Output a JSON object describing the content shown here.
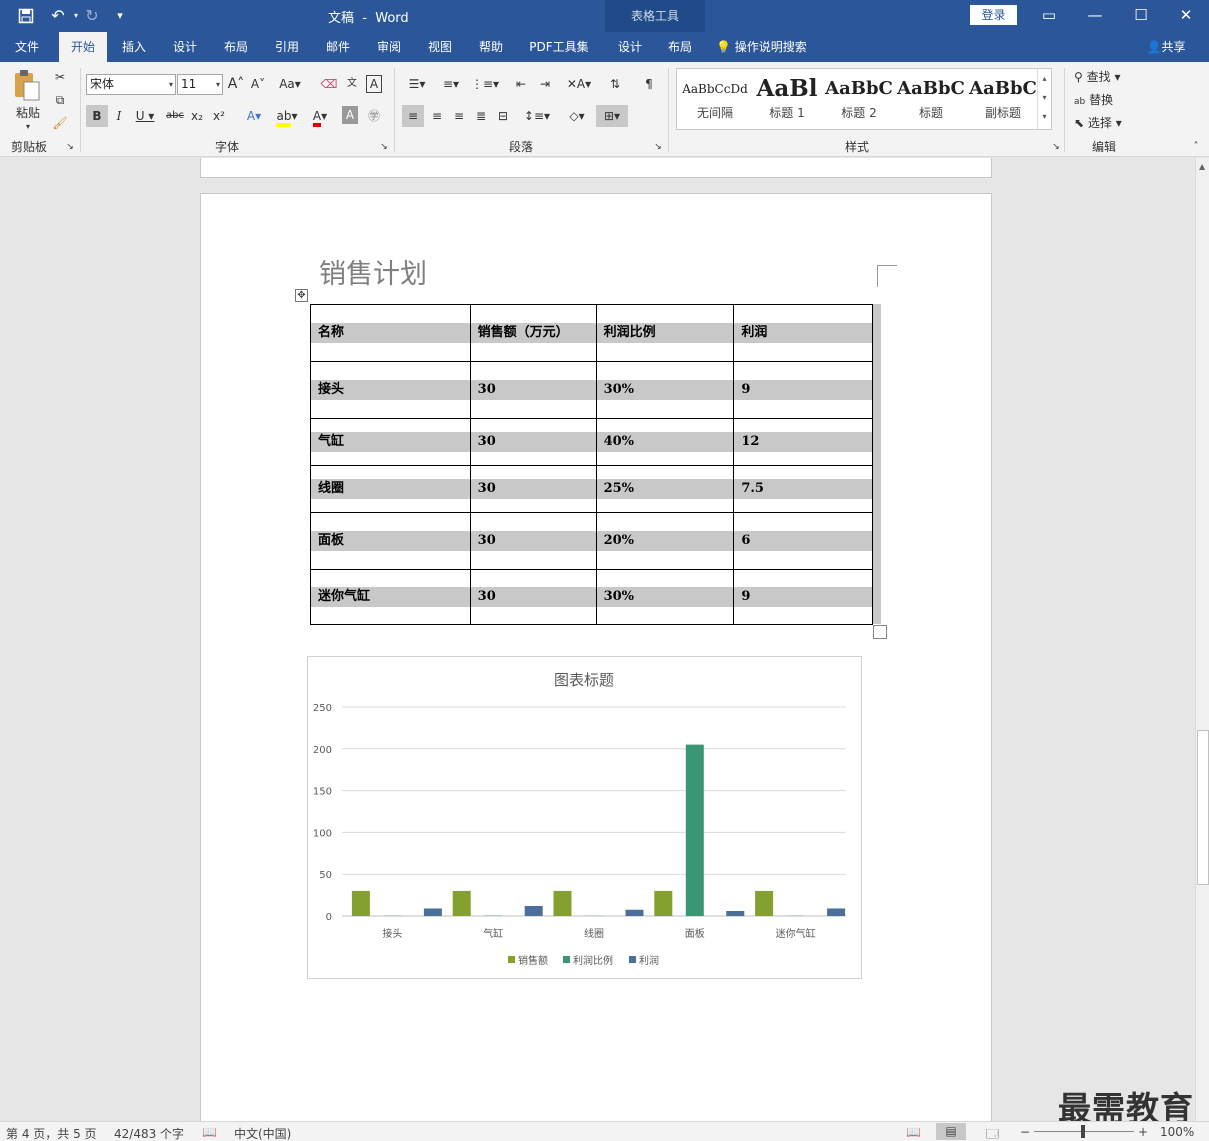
{
  "title_bar": {
    "doc_title": "文稿",
    "separator": "-",
    "app_name": "Word",
    "context_tools": "表格工具",
    "login": "登录"
  },
  "tabs": [
    "文件",
    "开始",
    "插入",
    "设计",
    "布局",
    "引用",
    "邮件",
    "审阅",
    "视图",
    "帮助",
    "PDF工具集",
    "设计",
    "布局"
  ],
  "active_tab": "开始",
  "tell_me": "操作说明搜索",
  "share": "共享",
  "ribbon": {
    "clipboard": {
      "paste": "粘贴",
      "label": "剪贴板"
    },
    "font": {
      "name": "宋体",
      "size": "11",
      "label": "字体"
    },
    "paragraph": {
      "label": "段落"
    },
    "styles": {
      "label": "样式",
      "items": [
        {
          "preview": "AaBbCcDd",
          "name": "无间隔"
        },
        {
          "preview": "AaBl",
          "name": "标题 1"
        },
        {
          "preview": "AaBbC",
          "name": "标题 2"
        },
        {
          "preview": "AaBbC",
          "name": "标题"
        },
        {
          "preview": "AaBbC",
          "name": "副标题"
        }
      ]
    },
    "editing": {
      "find": "查找",
      "replace": "替换",
      "select": "选择",
      "label": "编辑"
    }
  },
  "document": {
    "heading": "销售计划",
    "table": {
      "headers": [
        "名称",
        "销售额（万元）",
        "利润比例",
        "利润"
      ],
      "rows": [
        [
          "接头",
          "30",
          "30%",
          "9"
        ],
        [
          "气缸",
          "30",
          "40%",
          "12"
        ],
        [
          "线圈",
          "30",
          "25%",
          "7.5"
        ],
        [
          "面板",
          "30",
          "20%",
          "6"
        ],
        [
          "迷你气缸",
          "30",
          "30%",
          "9"
        ]
      ]
    }
  },
  "chart_data": {
    "type": "bar",
    "title": "图表标题",
    "categories": [
      "接头",
      "气缸",
      "线圈",
      "面板",
      "迷你气缸"
    ],
    "series": [
      {
        "name": "销售额",
        "values": [
          30,
          30,
          30,
          30,
          30
        ],
        "color": "#84a02f"
      },
      {
        "name": "利润比例",
        "values": [
          0.3,
          0.4,
          0.25,
          205,
          0.3
        ],
        "color": "#3a9673"
      },
      {
        "name": "利润",
        "values": [
          9,
          12,
          7.5,
          6,
          9
        ],
        "color": "#4a6f9a"
      }
    ],
    "yticks": [
      "0",
      "50",
      "100",
      "150",
      "200",
      "250"
    ],
    "ylim": [
      0,
      250
    ],
    "grid": true,
    "legend": "bottom"
  },
  "status": {
    "page": "第 4 页，共 5 页",
    "words": "42/483 个字",
    "language": "中文(中国)",
    "zoom": "100%",
    "minus": "−",
    "plus": "+"
  },
  "watermark": "最需教育",
  "colors": {
    "brand": "#2b579a",
    "context": "#204a88"
  }
}
